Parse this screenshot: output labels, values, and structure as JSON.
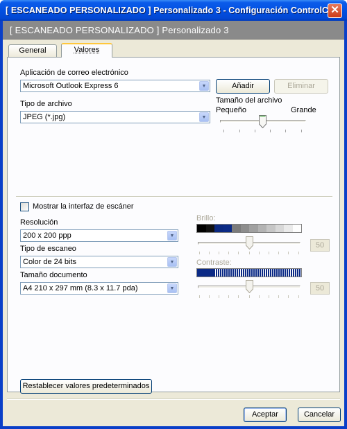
{
  "window": {
    "title": "[ ESCANEADO PERSONALIZADO ]  Personalizado 3 - Configuración ControlC..."
  },
  "banner": {
    "text": "[ ESCANEADO PERSONALIZADO ]  Personalizado 3"
  },
  "tabs": [
    {
      "label": "General",
      "selected": false
    },
    {
      "label": "Valores",
      "selected": true
    }
  ],
  "email_app": {
    "label": "Aplicación de correo electrónico",
    "value": "Microsoft Outlook Express 6",
    "add_button": "Añadir",
    "remove_button": "Eliminar"
  },
  "file_type": {
    "label": "Tipo de archivo",
    "value": "JPEG (*.jpg)"
  },
  "file_size": {
    "label": "Tamaño del archivo",
    "min_label": "Pequeño",
    "max_label": "Grande",
    "level_fraction": 0.5
  },
  "scanner_ui": {
    "label": "Mostrar la interfaz de escáner",
    "checked": false
  },
  "resolution": {
    "label": "Resolución",
    "value": "200 x 200 ppp"
  },
  "scan_type": {
    "label": "Tipo de escaneo",
    "value": "Color de 24 bits"
  },
  "doc_size": {
    "label": "Tamaño documento",
    "value": "A4 210 x 297 mm (8.3 x 11.7 pda)"
  },
  "brightness": {
    "label": "Brillo:",
    "value": "50"
  },
  "contrast": {
    "label": "Contraste:",
    "value": "50"
  },
  "reset_button": "Restablecer valores predeterminados",
  "ok_button": "Aceptar",
  "cancel_button": "Cancelar",
  "colors": {
    "titlebar": "#0250e2",
    "dialog": "#ece9d8",
    "banner": "#8a8a8a",
    "tab_accent": "#ffc73c"
  }
}
